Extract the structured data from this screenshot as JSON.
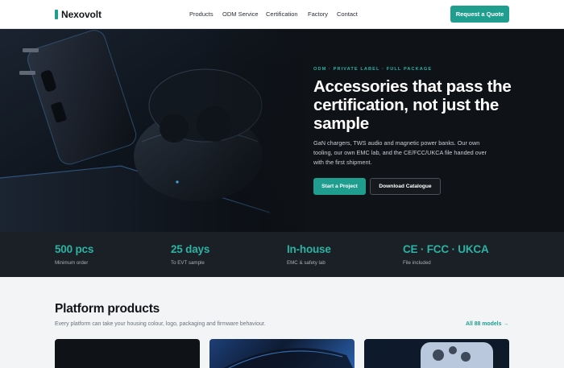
{
  "header": {
    "brand": "Nexovolt",
    "nav": [
      "Products",
      "ODM Service",
      "Certification",
      "Factory",
      "Contact"
    ],
    "cta": "Request a Quote"
  },
  "hero": {
    "eyebrow": "ODM · PRIVATE LABEL · FULL PACKAGE",
    "title": "Accessories that pass the certification, not just the sample",
    "subtitle": "GaN chargers, TWS audio and magnetic power banks. Our own tooling, our own EMC lab, and the CE/FCC/UKCA file handed over with the first shipment.",
    "primary_button": "Start a Project",
    "secondary_button": "Download Catalogue"
  },
  "stats": [
    {
      "value": "500 pcs",
      "label": "Minimum order"
    },
    {
      "value": "25 days",
      "label": "To EVT sample"
    },
    {
      "value": "In-house",
      "label": "EMC & safety lab"
    },
    {
      "value": "CE · FCC · UKCA",
      "label": "File included"
    }
  ],
  "products": {
    "title": "Platform products",
    "subtitle": "Every platform can take your housing colour, logo, packaging and firmware behaviour.",
    "all_link": "All 88 models →"
  },
  "colors": {
    "accent": "#1f9e90",
    "accent_text": "#2bb3a3",
    "hero_bg": "#0f1216",
    "stats_bg": "#1b1f26",
    "section_bg": "#f3f4f6"
  }
}
